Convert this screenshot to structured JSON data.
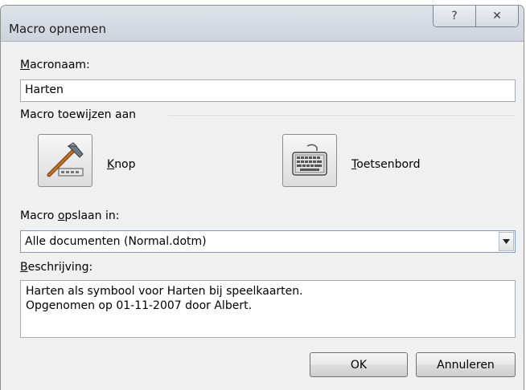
{
  "window": {
    "title": "Macro opnemen",
    "help_glyph": "?",
    "close_glyph": "✕"
  },
  "macro_name": {
    "label_first": "M",
    "label_rest": "acronaam:",
    "value": "Harten"
  },
  "assign": {
    "group_label": "Macro toewijzen aan",
    "button_label_first": "K",
    "button_label_rest": "nop",
    "keyboard_label_first": "T",
    "keyboard_label_rest": "oetsenbord",
    "button_icon": "hammer-icon",
    "keyboard_icon": "keyboard-icon"
  },
  "store": {
    "label_before": "Macro ",
    "label_key": "o",
    "label_after": "pslaan in:",
    "selected": "Alle documenten (Normal.dotm)"
  },
  "description": {
    "label_first": "B",
    "label_rest": "eschrijving:",
    "line1": "Harten als symbool voor Harten bij speelkaarten.",
    "line2": "Opgenomen op 01-11-2007 door Albert."
  },
  "buttons": {
    "ok": "OK",
    "cancel": "Annuleren"
  }
}
